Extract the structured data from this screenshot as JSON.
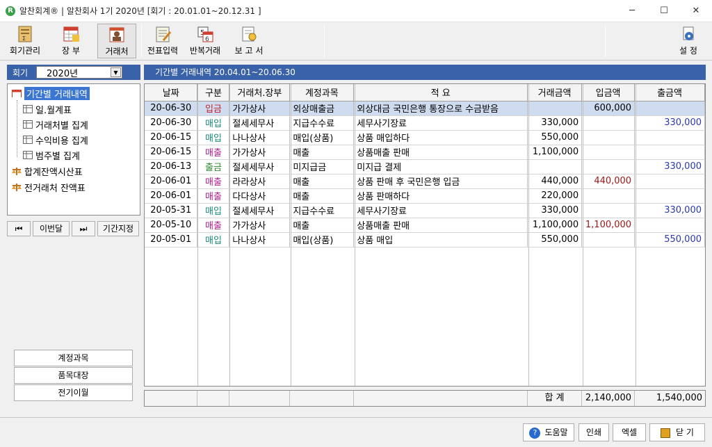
{
  "window": {
    "app_icon": "R",
    "title": "알찬회계® | 알찬회사 1기 2020년 [회기 : 20.01.01~20.12.31 ]",
    "minimize": "─",
    "maximize": "☐",
    "close": "✕"
  },
  "toolbar": {
    "account_mgmt": "회기관리",
    "ledger": "장 부",
    "vendor": "거래처",
    "voucher_input": "전표입력",
    "repeat_txn": "반복거래",
    "report": "보 고 서",
    "settings": "설 정"
  },
  "sidebar": {
    "period_label": "회기",
    "period_value": "2020년",
    "tree": [
      "기간별 거래내역",
      "일.월계표",
      "거래처별 집계",
      "수익비용 집계",
      "범주별 집계",
      "합계잔액시산표",
      "전거래처 잔액표"
    ],
    "nav": {
      "first": "⏮",
      "this_month": "이번달",
      "last": "⏭",
      "period_set": "기간지정"
    },
    "bottom": [
      "계정과목",
      "품목대장",
      "전기이월"
    ]
  },
  "main": {
    "header": "기간별 거래내역  20.04.01~20.06.30",
    "columns": [
      "날짜",
      "구분",
      "거래처.장부",
      "계정과목",
      "적 요",
      "거래금액",
      "입금액",
      "출금액"
    ],
    "rows": [
      {
        "date": "20-06-30",
        "type": "입금",
        "vendor": "가가상사",
        "account": "외상매출금",
        "memo": "외상대금 국민은행 통장으로 수금받음",
        "amount": "",
        "deposit": "600,000",
        "withdraw": ""
      },
      {
        "date": "20-06-30",
        "type": "매입",
        "vendor": "절세세무사",
        "account": "지급수수료",
        "memo": "세무사기장료",
        "amount": "330,000",
        "deposit": "",
        "withdraw": "330,000"
      },
      {
        "date": "20-06-15",
        "type": "매입",
        "vendor": "나나상사",
        "account": "매입(상품)",
        "memo": "상품 매입하다",
        "amount": "550,000",
        "deposit": "",
        "withdraw": ""
      },
      {
        "date": "20-06-15",
        "type": "매출",
        "vendor": "가가상사",
        "account": "매출",
        "memo": "상품매출 판매",
        "amount": "1,100,000",
        "deposit": "",
        "withdraw": ""
      },
      {
        "date": "20-06-13",
        "type": "출금",
        "vendor": "절세세무사",
        "account": "미지급금",
        "memo": "미지급 결제",
        "amount": "",
        "deposit": "",
        "withdraw": "330,000"
      },
      {
        "date": "20-06-01",
        "type": "매출",
        "vendor": "라라상사",
        "account": "매출",
        "memo": "상품 판매 후 국민은행 입금",
        "amount": "440,000",
        "deposit": "440,000",
        "withdraw": ""
      },
      {
        "date": "20-06-01",
        "type": "매출",
        "vendor": "다다상사",
        "account": "매출",
        "memo": "상품 판매하다",
        "amount": "220,000",
        "deposit": "",
        "withdraw": ""
      },
      {
        "date": "20-05-31",
        "type": "매입",
        "vendor": "절세세무사",
        "account": "지급수수료",
        "memo": "세무사기장료",
        "amount": "330,000",
        "deposit": "",
        "withdraw": "330,000"
      },
      {
        "date": "20-05-10",
        "type": "매출",
        "vendor": "가가상사",
        "account": "매출",
        "memo": "상품매출 판매",
        "amount": "1,100,000",
        "deposit": "1,100,000",
        "withdraw": ""
      },
      {
        "date": "20-05-01",
        "type": "매입",
        "vendor": "나나상사",
        "account": "매입(상품)",
        "memo": "상품 매입",
        "amount": "550,000",
        "deposit": "",
        "withdraw": "550,000"
      }
    ],
    "total": {
      "label": "합 계",
      "deposit": "2,140,000",
      "withdraw": "1,540,000"
    }
  },
  "footer": {
    "help": "도움말",
    "print": "인쇄",
    "excel": "엑셀",
    "close": "닫 기"
  },
  "colors": {
    "header_blue": "#3a62a8",
    "deposit_type": "#c0202a",
    "purchase_type": "#1a8a7a",
    "sales_type": "#b02090",
    "withdraw_type": "#2a8a2a",
    "withdraw_amount": "#2a3ab0",
    "deposit_amount": "#a01818"
  }
}
